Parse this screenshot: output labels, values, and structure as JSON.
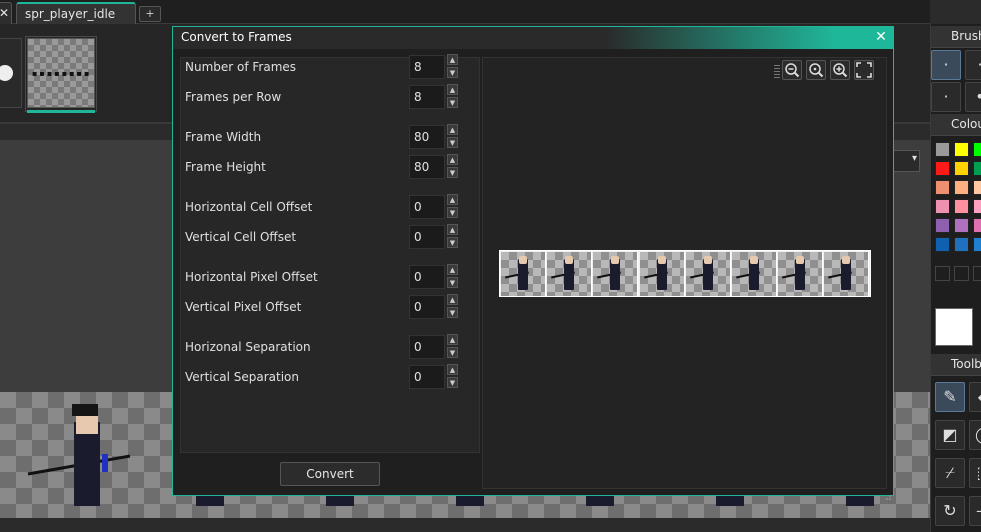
{
  "tabs": {
    "prev_tab_close": "✕",
    "active_label": "spr_player_idle",
    "active_close": "✕",
    "add_label": "+"
  },
  "dialog": {
    "title": "Convert to Frames",
    "close_label": "✕",
    "convert_label": "Convert",
    "fields": [
      {
        "label": "Number of Frames",
        "value": "8"
      },
      {
        "label": "Frames per Row",
        "value": "8"
      },
      {
        "label": "Frame Width",
        "value": "80"
      },
      {
        "label": "Frame Height",
        "value": "80"
      },
      {
        "label": "Horizontal Cell Offset",
        "value": "0"
      },
      {
        "label": "Vertical Cell Offset",
        "value": "0"
      },
      {
        "label": "Horizontal Pixel Offset",
        "value": "0"
      },
      {
        "label": "Vertical Pixel Offset",
        "value": "0"
      },
      {
        "label": "Horizonal Separation",
        "value": "0"
      },
      {
        "label": "Vertical Separation",
        "value": "0"
      }
    ],
    "preview_frame_count": 8,
    "zoom_icons": [
      "zoom-out-icon",
      "zoom-reset-icon",
      "zoom-in-icon",
      "fit-to-window-icon"
    ]
  },
  "right_panel": {
    "brushes_header": "Brushes",
    "colours_header": "Colours",
    "toolbox_header": "Toolbox",
    "swatches": [
      "#9a9a9a",
      "#ffff00",
      "#00ff00",
      "#ff1a1a",
      "#ffd200",
      "#00a050",
      "#ee9070",
      "#ffb080",
      "#ffc8a0",
      "#ee90b0",
      "#ff90a0",
      "#ffa0c0",
      "#9060b0",
      "#b070c0",
      "#e070b0",
      "#1060b0",
      "#2070c0",
      "#2080d0"
    ],
    "accent_color": "#1fb79a"
  }
}
